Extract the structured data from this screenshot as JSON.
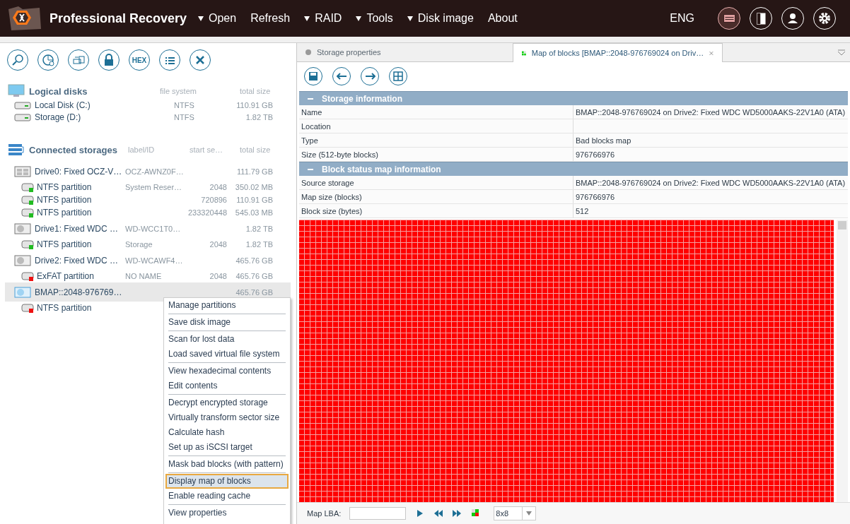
{
  "app": {
    "title": "Professional Recovery",
    "language": "ENG",
    "menu": [
      {
        "label": "Open",
        "dropdown": true
      },
      {
        "label": "Refresh",
        "dropdown": false
      },
      {
        "label": "RAID",
        "dropdown": true
      },
      {
        "label": "Tools",
        "dropdown": true
      },
      {
        "label": "Disk image",
        "dropdown": true
      },
      {
        "label": "About",
        "dropdown": false
      }
    ]
  },
  "left_toolbar": {
    "hex_label": "HEX"
  },
  "sections": [
    {
      "kind": "logical",
      "title": "Logical disks",
      "headers": {
        "label": "file system",
        "size": "total size"
      },
      "rows": [
        {
          "kind": "volume",
          "name": "Local Disk (C:)",
          "label": "NTFS",
          "size": "110.91 GB",
          "selected": false
        },
        {
          "kind": "volume",
          "name": "Storage (D:)",
          "label": "NTFS",
          "size": "1.82 TB",
          "selected": false
        }
      ]
    },
    {
      "kind": "storages",
      "title": "Connected storages",
      "headers": {
        "label": "label/ID",
        "start": "start se…",
        "size": "total size"
      },
      "rows": [
        {
          "kind": "drive",
          "name": "Drive0: Fixed OCZ-V…",
          "label": "OCZ-AWNZ0F…",
          "size": "111.79 GB",
          "selected": false,
          "children": [
            {
              "kind": "partition",
              "color": "#22bb22",
              "name": "NTFS partition",
              "label": "System Reser…",
              "start": "2048",
              "size": "350.02 MB",
              "selected": false
            },
            {
              "kind": "partition",
              "color": "#22bb22",
              "name": "NTFS partition",
              "start": "720896",
              "size": "110.91 GB",
              "selected": false
            },
            {
              "kind": "partition",
              "color": "#22bb22",
              "name": "NTFS partition",
              "start": "233320448",
              "size": "545.03 MB",
              "selected": false
            }
          ]
        },
        {
          "kind": "hdd",
          "name": "Drive1: Fixed WDC …",
          "label": "WD-WCC1T0…",
          "size": "1.82 TB",
          "selected": false,
          "children": [
            {
              "kind": "partition",
              "color": "#22bb22",
              "name": "NTFS partition",
              "label": "Storage",
              "start": "2048",
              "size": "1.82 TB",
              "selected": false
            }
          ]
        },
        {
          "kind": "hdd",
          "name": "Drive2: Fixed WDC …",
          "label": "WD-WCAWF4…",
          "size": "465.76 GB",
          "selected": false,
          "children": [
            {
              "kind": "partition",
              "color": "#ee1111",
              "name": "ExFAT partition",
              "label": "NO NAME",
              "start": "2048",
              "size": "465.76 GB",
              "selected": false
            }
          ]
        },
        {
          "kind": "bmap",
          "name": "BMAP::2048-976769…",
          "size": "465.76 GB",
          "selected": true,
          "children": [
            {
              "kind": "partition",
              "color": "#ee1111",
              "name": "NTFS partition",
              "selected": false
            }
          ]
        }
      ]
    }
  ],
  "context_menu": {
    "groups": [
      {
        "items": [
          {
            "label": "Manage partitions",
            "selected": false
          }
        ]
      },
      {
        "items": [
          {
            "label": "Save disk image",
            "selected": false
          }
        ]
      },
      {
        "items": [
          {
            "label": "Scan for lost data",
            "selected": false
          },
          {
            "label": "Load saved virtual file system",
            "selected": false
          }
        ]
      },
      {
        "items": [
          {
            "label": "View hexadecimal contents",
            "selected": false
          },
          {
            "label": "Edit contents",
            "selected": false
          }
        ]
      },
      {
        "items": [
          {
            "label": "Decrypt encrypted storage",
            "selected": false
          },
          {
            "label": "Virtually transform sector size",
            "selected": false
          },
          {
            "label": "Calculate hash",
            "selected": false
          },
          {
            "label": "Set up as iSCSI target",
            "selected": false
          }
        ]
      },
      {
        "items": [
          {
            "label": "Mask bad blocks (with pattern)",
            "selected": false
          }
        ]
      },
      {
        "items": [
          {
            "label": "Display map of blocks",
            "selected": true
          },
          {
            "label": "Enable reading cache",
            "selected": false
          }
        ]
      },
      {
        "items": [
          {
            "label": "View properties",
            "selected": false
          }
        ]
      }
    ]
  },
  "tabs": [
    {
      "kind": "dot",
      "label": "Storage properties",
      "selected": false,
      "closable": false
    },
    {
      "kind": "map",
      "label": "Map of blocks [BMAP::2048-976769024 on Driv…",
      "selected": true,
      "closable": true
    }
  ],
  "properties": [
    {
      "title": "Storage information",
      "expanded": true,
      "rows": [
        {
          "name": "Name",
          "value": "BMAP::2048-976769024 on Drive2: Fixed WDC WD5000AAKS-22V1A0 (ATA)"
        },
        {
          "name": "Location"
        },
        {
          "name": "Type",
          "value": "Bad blocks map"
        },
        {
          "name": "Size (512-byte blocks)",
          "value": "976766976"
        }
      ]
    },
    {
      "title": "Block status map information",
      "expanded": true,
      "rows": [
        {
          "name": "Source storage",
          "value": "BMAP::2048-976769024 on Drive2: Fixed WDC WD5000AAKS-22V1A0 (ATA)"
        },
        {
          "name": "Map size (blocks)",
          "value": "976766976"
        },
        {
          "name": "Block size (bytes)",
          "value": "512"
        }
      ]
    }
  ],
  "map_bar": {
    "label": "Map LBA:",
    "cell_size": "8x8"
  }
}
